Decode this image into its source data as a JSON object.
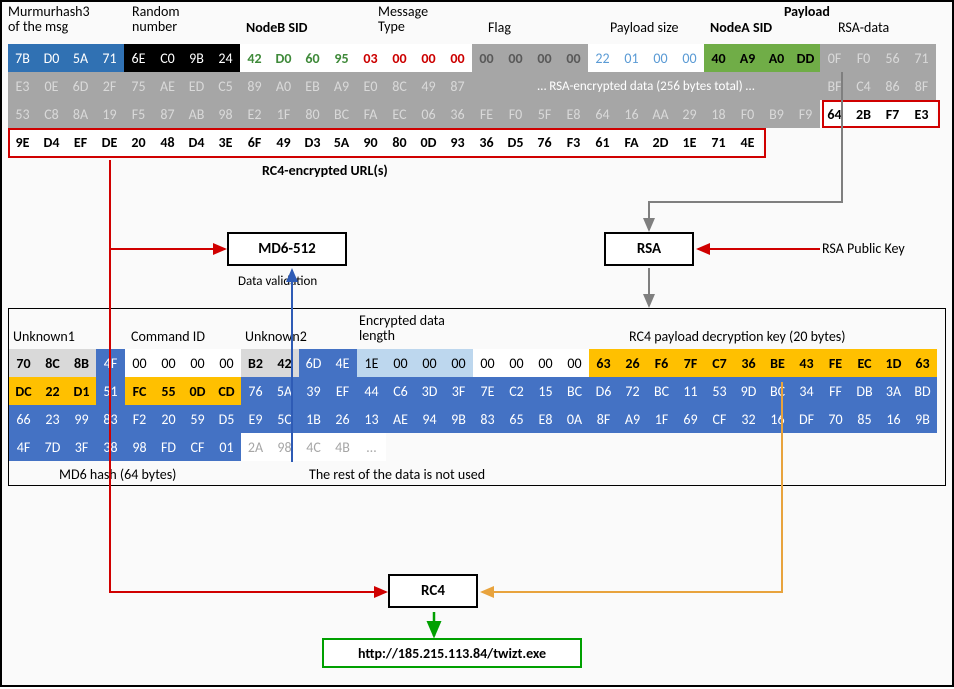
{
  "headers": {
    "murmur": "Murmurhash3\nof the msg",
    "random": "Random\nnumber",
    "nodeb": "NodeB SID",
    "mtype": "Message\nType",
    "flag": "Flag",
    "psize": "Payload size",
    "payload": "Payload",
    "nodea": "NodeA SID",
    "rsadata": "RSA-data"
  },
  "top_rows": [
    [
      {
        "t": "7B",
        "c": "mm"
      },
      {
        "t": "D0",
        "c": "mm"
      },
      {
        "t": "5A",
        "c": "mm"
      },
      {
        "t": "71",
        "c": "mm"
      },
      {
        "t": "6E",
        "c": "rnd"
      },
      {
        "t": "C0",
        "c": "rnd"
      },
      {
        "t": "9B",
        "c": "rnd"
      },
      {
        "t": "24",
        "c": "rnd"
      },
      {
        "t": "42",
        "c": "nodeb"
      },
      {
        "t": "D0",
        "c": "nodeb"
      },
      {
        "t": "60",
        "c": "nodeb"
      },
      {
        "t": "95",
        "c": "nodeb"
      },
      {
        "t": "03",
        "c": "mtype"
      },
      {
        "t": "00",
        "c": "mtype"
      },
      {
        "t": "00",
        "c": "mtype"
      },
      {
        "t": "00",
        "c": "mtype"
      },
      {
        "t": "00",
        "c": "flg"
      },
      {
        "t": "00",
        "c": "flg"
      },
      {
        "t": "00",
        "c": "flg"
      },
      {
        "t": "00",
        "c": "flg"
      },
      {
        "t": "22",
        "c": "psize"
      },
      {
        "t": "01",
        "c": "psize"
      },
      {
        "t": "00",
        "c": "psize"
      },
      {
        "t": "00",
        "c": "psize"
      },
      {
        "t": "40",
        "c": "nodea"
      },
      {
        "t": "A9",
        "c": "nodea"
      },
      {
        "t": "A0",
        "c": "nodea"
      },
      {
        "t": "DD",
        "c": "nodea"
      },
      {
        "t": "0F",
        "c": "rsa"
      },
      {
        "t": "F0",
        "c": "rsa"
      },
      {
        "t": "56",
        "c": "rsa"
      },
      {
        "t": "71",
        "c": "rsa"
      }
    ],
    [
      {
        "t": "E3",
        "c": "rsa"
      },
      {
        "t": "0E",
        "c": "rsa"
      },
      {
        "t": "6D",
        "c": "rsa"
      },
      {
        "t": "2F",
        "c": "rsa"
      },
      {
        "t": "75",
        "c": "rsa"
      },
      {
        "t": "AE",
        "c": "rsa"
      },
      {
        "t": "ED",
        "c": "rsa"
      },
      {
        "t": "C5",
        "c": "rsa"
      },
      {
        "t": "89",
        "c": "rsa"
      },
      {
        "t": "A0",
        "c": "rsa"
      },
      {
        "t": "EB",
        "c": "rsa"
      },
      {
        "t": "A9",
        "c": "rsa"
      },
      {
        "t": "E0",
        "c": "rsa"
      },
      {
        "t": "8C",
        "c": "rsa"
      },
      {
        "t": "49",
        "c": "rsa"
      },
      {
        "t": "87",
        "c": "rsa"
      },
      {
        "t": "… RSA-encrypted data (256 bytes total) …",
        "c": "rsatxt",
        "span": 12
      },
      {
        "t": "BF",
        "c": "rsa"
      },
      {
        "t": "C4",
        "c": "rsa"
      },
      {
        "t": "86",
        "c": "rsa"
      },
      {
        "t": "8F",
        "c": "rsa"
      }
    ],
    [
      {
        "t": "53",
        "c": "rsa"
      },
      {
        "t": "C8",
        "c": "rsa"
      },
      {
        "t": "8A",
        "c": "rsa"
      },
      {
        "t": "19",
        "c": "rsa"
      },
      {
        "t": "F5",
        "c": "rsa"
      },
      {
        "t": "87",
        "c": "rsa"
      },
      {
        "t": "AB",
        "c": "rsa"
      },
      {
        "t": "98",
        "c": "rsa"
      },
      {
        "t": "E2",
        "c": "rsa"
      },
      {
        "t": "1F",
        "c": "rsa"
      },
      {
        "t": "80",
        "c": "rsa"
      },
      {
        "t": "BC",
        "c": "rsa"
      },
      {
        "t": "FA",
        "c": "rsa"
      },
      {
        "t": "EC",
        "c": "rsa"
      },
      {
        "t": "06",
        "c": "rsa"
      },
      {
        "t": "36",
        "c": "rsa"
      },
      {
        "t": "FE",
        "c": "rsa"
      },
      {
        "t": "F0",
        "c": "rsa"
      },
      {
        "t": "5F",
        "c": "rsa"
      },
      {
        "t": "E8",
        "c": "rsa"
      },
      {
        "t": "64",
        "c": "rsa"
      },
      {
        "t": "16",
        "c": "rsa"
      },
      {
        "t": "AA",
        "c": "rsa"
      },
      {
        "t": "29",
        "c": "rsa"
      },
      {
        "t": "18",
        "c": "rsa"
      },
      {
        "t": "F0",
        "c": "rsa"
      },
      {
        "t": "B9",
        "c": "rsa"
      },
      {
        "t": "F9",
        "c": "rsa"
      },
      {
        "t": "64",
        "c": "rc4b"
      },
      {
        "t": "2B",
        "c": "rc4b"
      },
      {
        "t": "F7",
        "c": "rc4b"
      },
      {
        "t": "E3",
        "c": "rc4b"
      }
    ],
    [
      {
        "t": "9E",
        "c": "rc4b"
      },
      {
        "t": "D4",
        "c": "rc4b"
      },
      {
        "t": "EF",
        "c": "rc4b"
      },
      {
        "t": "DE",
        "c": "rc4b"
      },
      {
        "t": "20",
        "c": "rc4b"
      },
      {
        "t": "48",
        "c": "rc4b"
      },
      {
        "t": "D4",
        "c": "rc4b"
      },
      {
        "t": "3E",
        "c": "rc4b"
      },
      {
        "t": "6F",
        "c": "rc4b"
      },
      {
        "t": "49",
        "c": "rc4b"
      },
      {
        "t": "D3",
        "c": "rc4b"
      },
      {
        "t": "5A",
        "c": "rc4b"
      },
      {
        "t": "90",
        "c": "rc4b"
      },
      {
        "t": "80",
        "c": "rc4b"
      },
      {
        "t": "0D",
        "c": "rc4b"
      },
      {
        "t": "93",
        "c": "rc4b"
      },
      {
        "t": "36",
        "c": "rc4b"
      },
      {
        "t": "D5",
        "c": "rc4b"
      },
      {
        "t": "76",
        "c": "rc4b"
      },
      {
        "t": "F3",
        "c": "rc4b"
      },
      {
        "t": "61",
        "c": "rc4b"
      },
      {
        "t": "FA",
        "c": "rc4b"
      },
      {
        "t": "2D",
        "c": "rc4b"
      },
      {
        "t": "1E",
        "c": "rc4b"
      },
      {
        "t": "71",
        "c": "rc4b"
      },
      {
        "t": "4E",
        "c": "rc4b"
      }
    ]
  ],
  "rc4_caption": "RC4-encrypted URL(s)",
  "md6_label": "MD6-512",
  "md6_sub": "Data validation",
  "rsa_label": "RSA",
  "rsa_key_label": "RSA Public Key",
  "mid_headers": {
    "unk1": "Unknown1",
    "cmd": "Command ID",
    "unk2": "Unknown2",
    "elen": "Encrypted data\nlength",
    "rkey": "RC4 payload decryption key (20 bytes)"
  },
  "mid_rows": [
    [
      {
        "t": "70",
        "c": "unk"
      },
      {
        "t": "8C",
        "c": "unk"
      },
      {
        "t": "8B",
        "c": "unk"
      },
      {
        "t": "4F",
        "c": "md6h"
      },
      {
        "t": "00",
        "c": "cmd"
      },
      {
        "t": "00",
        "c": "cmd"
      },
      {
        "t": "00",
        "c": "cmd"
      },
      {
        "t": "00",
        "c": "cmd"
      },
      {
        "t": "B2",
        "c": "unk2"
      },
      {
        "t": "42",
        "c": "unk2"
      },
      {
        "t": "6D",
        "c": "md6h"
      },
      {
        "t": "4E",
        "c": "md6h"
      },
      {
        "t": "1E",
        "c": "elen"
      },
      {
        "t": "00",
        "c": "elen"
      },
      {
        "t": "00",
        "c": "elen"
      },
      {
        "t": "00",
        "c": "elen"
      },
      {
        "t": "00",
        "c": "zero"
      },
      {
        "t": "00",
        "c": "zero"
      },
      {
        "t": "00",
        "c": "zero"
      },
      {
        "t": "00",
        "c": "zero"
      },
      {
        "t": "63",
        "c": "rkey"
      },
      {
        "t": "26",
        "c": "rkey"
      },
      {
        "t": "F6",
        "c": "rkey"
      },
      {
        "t": "7F",
        "c": "rkey"
      },
      {
        "t": "C7",
        "c": "rkey"
      },
      {
        "t": "36",
        "c": "rkey"
      },
      {
        "t": "BE",
        "c": "rkey"
      },
      {
        "t": "43",
        "c": "rkey"
      },
      {
        "t": "FE",
        "c": "rkey"
      },
      {
        "t": "EC",
        "c": "rkey"
      },
      {
        "t": "1D",
        "c": "rkey"
      },
      {
        "t": "63",
        "c": "rkey"
      }
    ],
    [
      {
        "t": "DC",
        "c": "rfill"
      },
      {
        "t": "22",
        "c": "rfill"
      },
      {
        "t": "D1",
        "c": "rfill"
      },
      {
        "t": "51",
        "c": "md6h"
      },
      {
        "t": "FC",
        "c": "rfill"
      },
      {
        "t": "55",
        "c": "rfill"
      },
      {
        "t": "0D",
        "c": "rfill"
      },
      {
        "t": "CD",
        "c": "rfill"
      },
      {
        "t": "76",
        "c": "md6h"
      },
      {
        "t": "5A",
        "c": "md6h"
      },
      {
        "t": "39",
        "c": "md6h"
      },
      {
        "t": "EF",
        "c": "md6h"
      },
      {
        "t": "44",
        "c": "md6h"
      },
      {
        "t": "C6",
        "c": "md6h"
      },
      {
        "t": "3D",
        "c": "md6h"
      },
      {
        "t": "3F",
        "c": "md6h"
      },
      {
        "t": "7E",
        "c": "md6h"
      },
      {
        "t": "C2",
        "c": "md6h"
      },
      {
        "t": "15",
        "c": "md6h"
      },
      {
        "t": "BC",
        "c": "md6h"
      },
      {
        "t": "D6",
        "c": "md6h"
      },
      {
        "t": "72",
        "c": "md6h"
      },
      {
        "t": "BC",
        "c": "md6h"
      },
      {
        "t": "11",
        "c": "md6h"
      },
      {
        "t": "53",
        "c": "md6h"
      },
      {
        "t": "9D",
        "c": "md6h"
      },
      {
        "t": "BC",
        "c": "md6h"
      },
      {
        "t": "34",
        "c": "md6h"
      },
      {
        "t": "FF",
        "c": "md6h"
      },
      {
        "t": "DB",
        "c": "md6h"
      },
      {
        "t": "3A",
        "c": "md6h"
      },
      {
        "t": "BD",
        "c": "md6h"
      }
    ],
    [
      {
        "t": "66",
        "c": "md6h"
      },
      {
        "t": "23",
        "c": "md6h"
      },
      {
        "t": "99",
        "c": "md6h"
      },
      {
        "t": "83",
        "c": "md6h"
      },
      {
        "t": "F2",
        "c": "md6h"
      },
      {
        "t": "20",
        "c": "md6h"
      },
      {
        "t": "59",
        "c": "md6h"
      },
      {
        "t": "D5",
        "c": "md6h"
      },
      {
        "t": "E9",
        "c": "md6h"
      },
      {
        "t": "5C",
        "c": "md6h"
      },
      {
        "t": "1B",
        "c": "md6h"
      },
      {
        "t": "26",
        "c": "md6h"
      },
      {
        "t": "13",
        "c": "md6h"
      },
      {
        "t": "AE",
        "c": "md6h"
      },
      {
        "t": "94",
        "c": "md6h"
      },
      {
        "t": "9B",
        "c": "md6h"
      },
      {
        "t": "83",
        "c": "md6h"
      },
      {
        "t": "65",
        "c": "md6h"
      },
      {
        "t": "E8",
        "c": "md6h"
      },
      {
        "t": "0A",
        "c": "md6h"
      },
      {
        "t": "8F",
        "c": "md6h"
      },
      {
        "t": "A9",
        "c": "md6h"
      },
      {
        "t": "1F",
        "c": "md6h"
      },
      {
        "t": "69",
        "c": "md6h"
      },
      {
        "t": "CF",
        "c": "md6h"
      },
      {
        "t": "32",
        "c": "md6h"
      },
      {
        "t": "16",
        "c": "md6h"
      },
      {
        "t": "DF",
        "c": "md6h"
      },
      {
        "t": "70",
        "c": "md6h"
      },
      {
        "t": "85",
        "c": "md6h"
      },
      {
        "t": "16",
        "c": "md6h"
      },
      {
        "t": "9B",
        "c": "md6h"
      }
    ],
    [
      {
        "t": "4F",
        "c": "md6h"
      },
      {
        "t": "7D",
        "c": "md6h"
      },
      {
        "t": "3F",
        "c": "md6h"
      },
      {
        "t": "38",
        "c": "md6h"
      },
      {
        "t": "98",
        "c": "md6h"
      },
      {
        "t": "FD",
        "c": "md6h"
      },
      {
        "t": "CF",
        "c": "md6h"
      },
      {
        "t": "01",
        "c": "md6h"
      },
      {
        "t": "2A",
        "c": "rest"
      },
      {
        "t": "98",
        "c": "rest"
      },
      {
        "t": "4C",
        "c": "rest"
      },
      {
        "t": "4B",
        "c": "rest"
      },
      {
        "t": "…",
        "c": "rest"
      }
    ]
  ],
  "mid_caps": {
    "md6": "MD6 hash (64 bytes)",
    "rest": "The rest of the data is not used"
  },
  "rc4_label": "RC4",
  "url": "http://185.215.113.84/twizt.exe"
}
